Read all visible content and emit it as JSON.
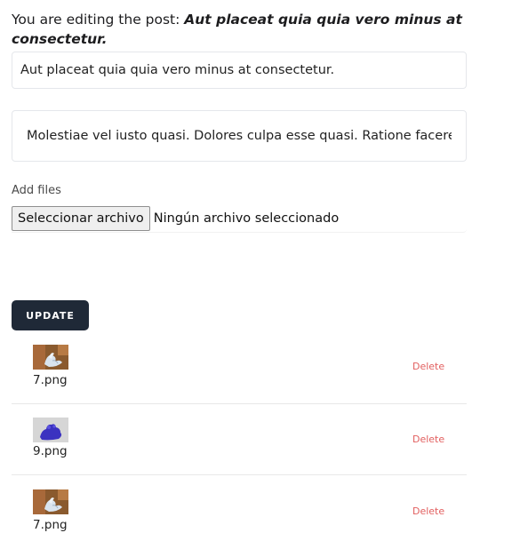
{
  "editor": {
    "heading_prefix": "You are editing the post: ",
    "post_title": "Aut placeat quia quia vero minus at consectetur.",
    "title_value": "Aut placeat quia quia vero minus at consectetur.",
    "body_value": "Molestiae vel iusto quasi. Dolores culpa esse quasi. Ratione facere"
  },
  "files": {
    "label": "Add files",
    "button_label": "Seleccionar archivo",
    "status": "Ningún archivo seleccionado"
  },
  "update_label": "UPDATE",
  "attachments": [
    {
      "name": "7.png",
      "delete_label": "Delete",
      "thumb": "swan-thumbnail-icon"
    },
    {
      "name": "9.png",
      "delete_label": "Delete",
      "thumb": "blue-figure-thumbnail-icon"
    },
    {
      "name": "7.png",
      "delete_label": "Delete",
      "thumb": "swan-thumbnail-icon"
    }
  ],
  "colors": {
    "update_bg": "#1f2937",
    "delete": "#e25f5f"
  }
}
